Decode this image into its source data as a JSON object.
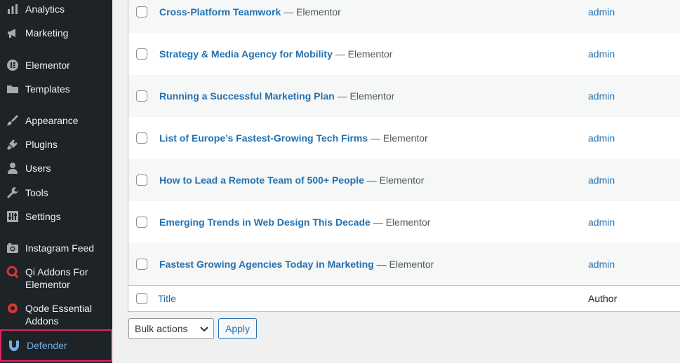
{
  "sidebar": {
    "items": [
      {
        "label": "Analytics",
        "icon": "bar-chart-icon"
      },
      {
        "label": "Marketing",
        "icon": "megaphone-icon"
      },
      {
        "label": "Elementor",
        "icon": "elementor-icon"
      },
      {
        "label": "Templates",
        "icon": "folder-icon"
      },
      {
        "label": "Appearance",
        "icon": "paintbrush-icon"
      },
      {
        "label": "Plugins",
        "icon": "plug-icon"
      },
      {
        "label": "Users",
        "icon": "user-icon"
      },
      {
        "label": "Tools",
        "icon": "wrench-icon"
      },
      {
        "label": "Settings",
        "icon": "sliders-icon"
      },
      {
        "label": "Instagram Feed",
        "icon": "camera-icon"
      },
      {
        "label": "Qi Addons For Elementor",
        "icon": "qi-icon"
      },
      {
        "label": "Qode Essential Addons",
        "icon": "qode-icon"
      },
      {
        "label": "Defender",
        "icon": "shield-icon"
      }
    ]
  },
  "table": {
    "rows": [
      {
        "title": "Cross-Platform Teamwork",
        "suffix": " — Elementor",
        "author": "admin"
      },
      {
        "title": "Strategy & Media Agency for Mobility",
        "suffix": " — Elementor",
        "author": "admin"
      },
      {
        "title": "Running a Successful Marketing Plan",
        "suffix": " — Elementor",
        "author": "admin"
      },
      {
        "title": "List of Europe’s Fastest-Growing Tech Firms",
        "suffix": " — Elementor",
        "author": "admin"
      },
      {
        "title": "How to Lead a Remote Team of 500+ People",
        "suffix": " — Elementor",
        "author": "admin"
      },
      {
        "title": "Emerging Trends in Web Design This Decade",
        "suffix": " — Elementor",
        "author": "admin"
      },
      {
        "title": "Fastest Growing Agencies Today in Marketing",
        "suffix": " — Elementor",
        "author": "admin"
      }
    ],
    "footer": {
      "title": "Title",
      "author": "Author"
    }
  },
  "bulk": {
    "select_label": "Bulk actions",
    "apply_label": "Apply"
  },
  "colors": {
    "sidebar_bg": "#1d2327",
    "link": "#2271b1",
    "highlight_border": "#e0245e"
  }
}
